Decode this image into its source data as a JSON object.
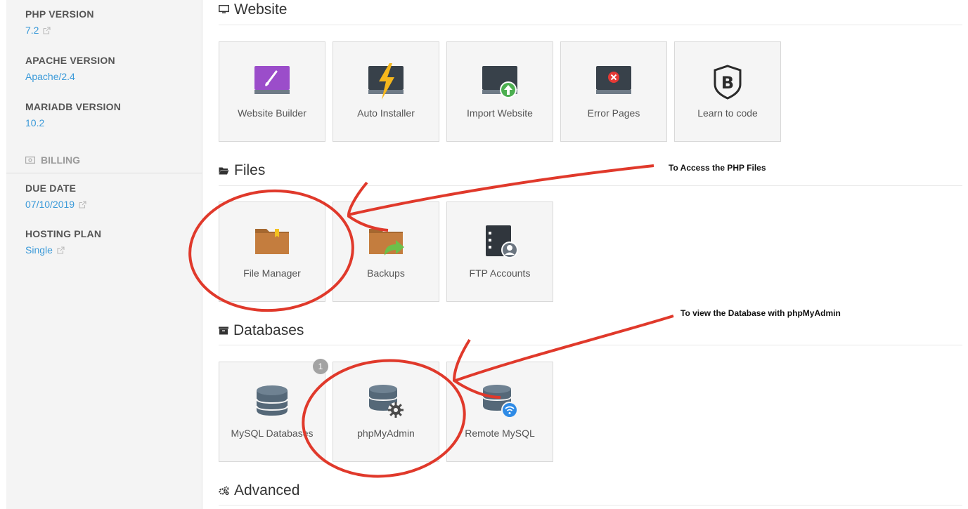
{
  "sidebar": {
    "php_version": {
      "label": "PHP VERSION",
      "value": "7.2"
    },
    "apache_version": {
      "label": "APACHE VERSION",
      "value": "Apache/2.4"
    },
    "mariadb_version": {
      "label": "MARIADB VERSION",
      "value": "10.2"
    },
    "billing": {
      "label": "BILLING"
    },
    "due_date": {
      "label": "DUE DATE",
      "value": "07/10/2019"
    },
    "hosting_plan": {
      "label": "HOSTING PLAN",
      "value": "Single"
    }
  },
  "sections": {
    "website": {
      "title": "Website",
      "tiles": [
        {
          "label": "Website Builder"
        },
        {
          "label": "Auto Installer"
        },
        {
          "label": "Import Website"
        },
        {
          "label": "Error Pages"
        },
        {
          "label": "Learn to code"
        }
      ]
    },
    "files": {
      "title": "Files",
      "tiles": [
        {
          "label": "File Manager"
        },
        {
          "label": "Backups"
        },
        {
          "label": "FTP Accounts"
        }
      ]
    },
    "databases": {
      "title": "Databases",
      "tiles": [
        {
          "label": "MySQL Databases",
          "badge": "1"
        },
        {
          "label": "phpMyAdmin"
        },
        {
          "label": "Remote MySQL"
        }
      ]
    },
    "advanced": {
      "title": "Advanced"
    }
  },
  "annotations": {
    "files_note": "To Access the PHP Files",
    "db_note": "To view the Database with phpMyAdmin"
  },
  "colors": {
    "link": "#3b9ad9",
    "annotation": "#e0392b",
    "tile_bg": "#f5f5f5"
  }
}
